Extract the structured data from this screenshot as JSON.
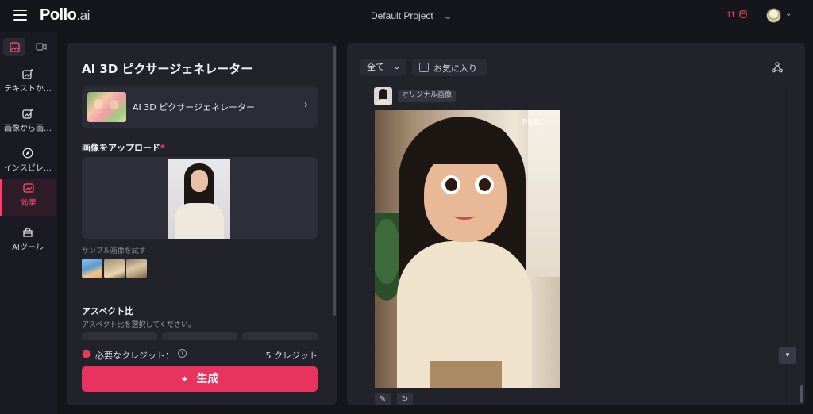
{
  "header": {
    "logo_main": "Pollo",
    "logo_suffix": ".ai",
    "project_name": "Default Project",
    "credits": "11"
  },
  "rail": {
    "items": [
      {
        "label": "テキストか…"
      },
      {
        "label": "画像から画…"
      },
      {
        "label": "インスピレ…"
      },
      {
        "label": "効果"
      },
      {
        "label": "AIツール"
      }
    ]
  },
  "panel": {
    "title": "AI 3D ピクサージェネレーター",
    "tool_card_label": "AI 3D ピクサージェネレーター",
    "upload_label": "画像をアップロード",
    "upload_required": "*",
    "sample_label": "サンプル画像を試す",
    "aspect_title": "アスペクト比",
    "aspect_subtitle": "アスペクト比を選択してください。",
    "credit_label": "必要なクレジット：",
    "credit_value": "5 クレジット",
    "generate_label": "生成"
  },
  "results": {
    "filter_value": "全て",
    "favorites_label": "お気に入り",
    "original_tag": "オリジナル画像",
    "watermark": "Pollo."
  },
  "colors": {
    "accent": "#e8335f",
    "active_rail": "#ff4d7a",
    "background": "#15151c",
    "panel": "#22222b"
  }
}
